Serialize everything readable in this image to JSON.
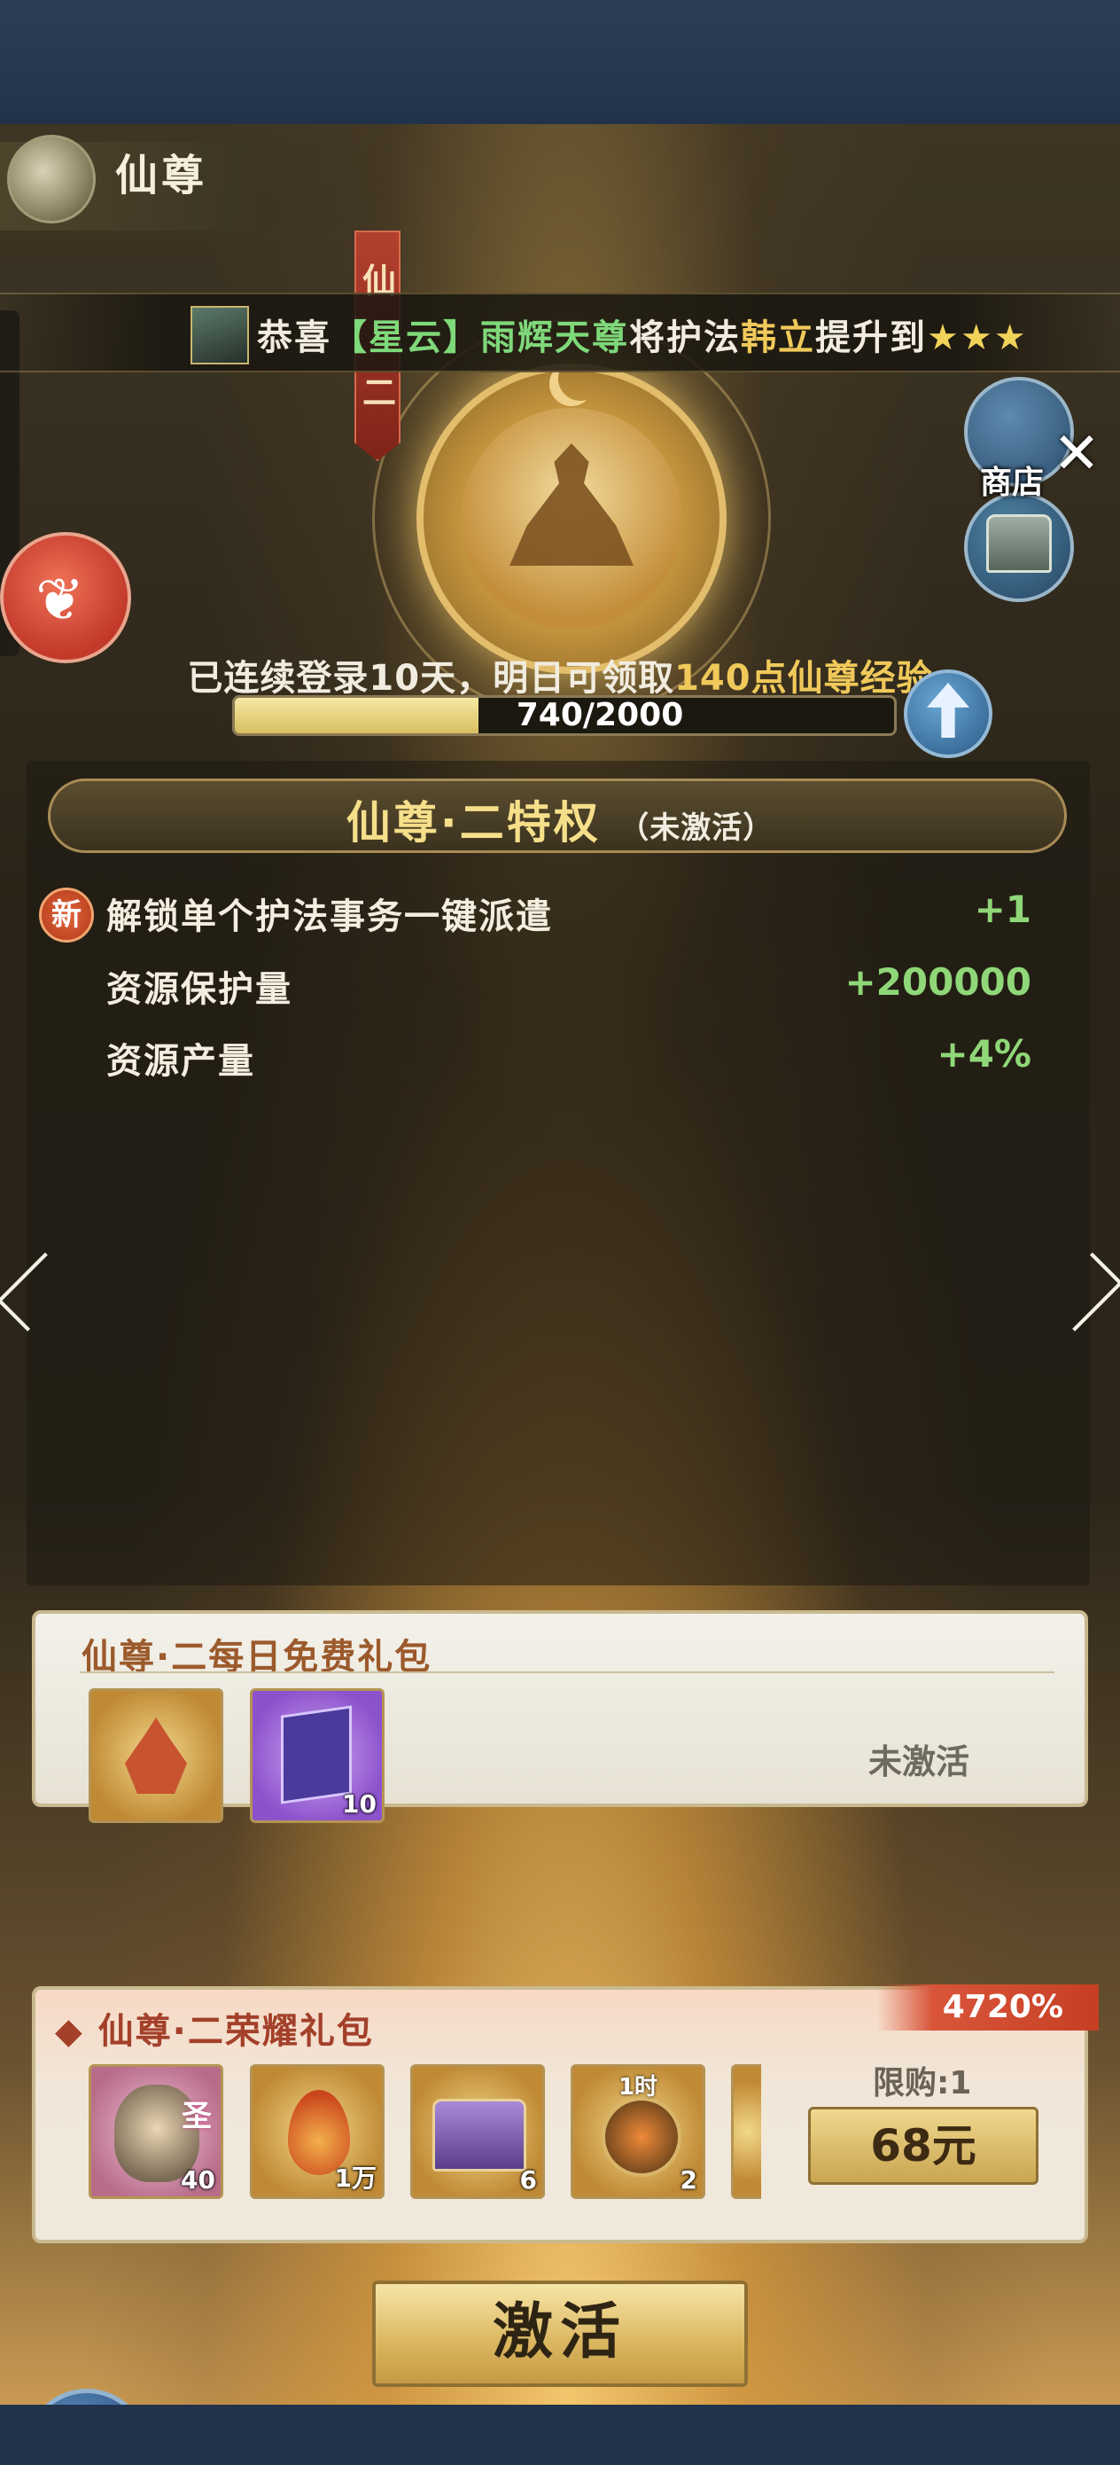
{
  "header": {
    "title": "仙尊"
  },
  "broadcast": {
    "prefix": "恭喜",
    "bracket_name": "【星云】",
    "player": "雨辉天尊",
    "mid": "将护法",
    "target": "韩立",
    "suffix": "提升到",
    "stars": "★★★"
  },
  "banner": {
    "chars": [
      "仙",
      "二"
    ]
  },
  "shop": {
    "label": "商店"
  },
  "progress": {
    "login_text": "已连续登录10天，明日可领取",
    "login_reward": "140点仙尊经验",
    "current": 740,
    "max": 2000,
    "label": "740/2000",
    "fill_fraction": 0.37
  },
  "privilege": {
    "title": "仙尊·二特权",
    "status": "（未激活）",
    "rows": [
      {
        "badge": "新",
        "label": "解锁单个护法事务一键派遣",
        "value": "+1"
      },
      {
        "badge": "",
        "label": "资源保护量",
        "value": "+200000"
      },
      {
        "badge": "",
        "label": "资源产量",
        "value": "+4%"
      }
    ]
  },
  "free_pack": {
    "title": "仙尊·二每日免费礼包",
    "status": "未激活",
    "items": [
      {
        "icon": "immortal-avatar-icon",
        "count": ""
      },
      {
        "icon": "purple-book-icon",
        "count": "10"
      }
    ]
  },
  "honor_pack": {
    "title": "仙尊·二荣耀礼包",
    "value_ribbon": "4720%",
    "limit": "限购:1",
    "price": "68元",
    "items": [
      {
        "icon": "monkey-king-icon",
        "corner": "圣",
        "tag": "",
        "count": "40"
      },
      {
        "icon": "flame-droplet-icon",
        "corner": "",
        "tag": "",
        "count": "1万"
      },
      {
        "icon": "treasure-chest-icon",
        "corner": "",
        "tag": "",
        "count": "6"
      },
      {
        "icon": "speedup-hammer-icon",
        "corner": "",
        "tag": "1时",
        "count": "2"
      }
    ]
  },
  "actions": {
    "activate": "激活"
  },
  "colors": {
    "accent_gold": "#f0c95a",
    "value_green": "#8fd778",
    "badge_red": "#d9553a"
  }
}
